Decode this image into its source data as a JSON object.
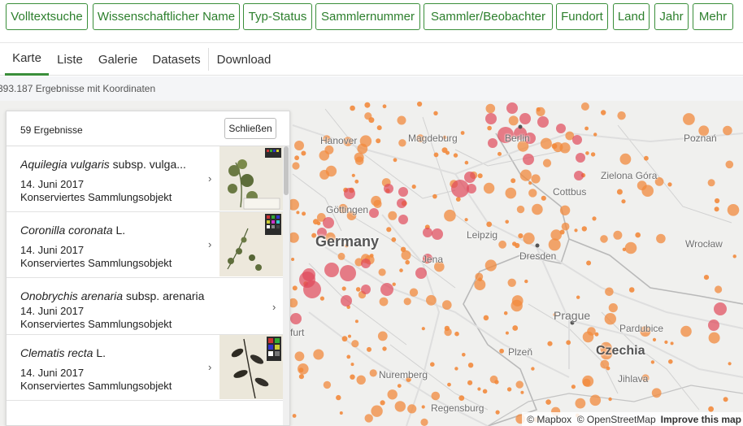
{
  "filters": [
    "Volltextsuche",
    "Wissenschaftlicher Name",
    "Typ-Status",
    "Sammlernummer",
    "Sammler/Beobachter",
    "Fundort",
    "Land",
    "Jahr",
    "Mehr"
  ],
  "tabs": [
    "Karte",
    "Liste",
    "Galerie",
    "Datasets",
    "Download"
  ],
  "active_tab": "Karte",
  "results_summary": "393.187 Ergebnisse mit Koordinaten",
  "panel": {
    "count": "59 Ergebnisse",
    "close_label": "Schließen",
    "items": [
      {
        "name_italic": "Aquilegia vulgaris",
        "name_rest": " subsp. vulga...",
        "date": "14. Juni 2017",
        "type": "Konserviertes Sammlungsobjekt",
        "has_image": true
      },
      {
        "name_italic": "Coronilla coronata",
        "name_rest": " L.",
        "date": "14. Juni 2017",
        "type": "Konserviertes Sammlungsobjekt",
        "has_image": true
      },
      {
        "name_italic": "Onobrychis arenaria",
        "name_rest": " subsp. arenaria",
        "date": "14. Juni 2017",
        "type": "Konserviertes Sammlungsobjekt",
        "has_image": false
      },
      {
        "name_italic": "Clematis recta",
        "name_rest": " L.",
        "date": "14. Juni 2017",
        "type": "Konserviertes Sammlungsobjekt",
        "has_image": true
      }
    ]
  },
  "map": {
    "places": [
      "Hanover",
      "Magdeburg",
      "Berlin",
      "Poznań",
      "Zielona Góra",
      "Cottbus",
      "Göttingen",
      "Germany",
      "Leipzig",
      "Jena",
      "Dresden",
      "Wrocław",
      "Prague",
      "Czechia",
      "Pardubice",
      "Plzeň",
      "Nuremberg",
      "Jihlava",
      "Regensburg",
      "furt"
    ],
    "attribution": [
      "© Mapbox",
      "© OpenStreetMap",
      "Improve this map"
    ],
    "marker_color": "#f28a3c",
    "cluster_color": "#e0495a"
  },
  "colors": {
    "accent": "#3a8e3a"
  }
}
